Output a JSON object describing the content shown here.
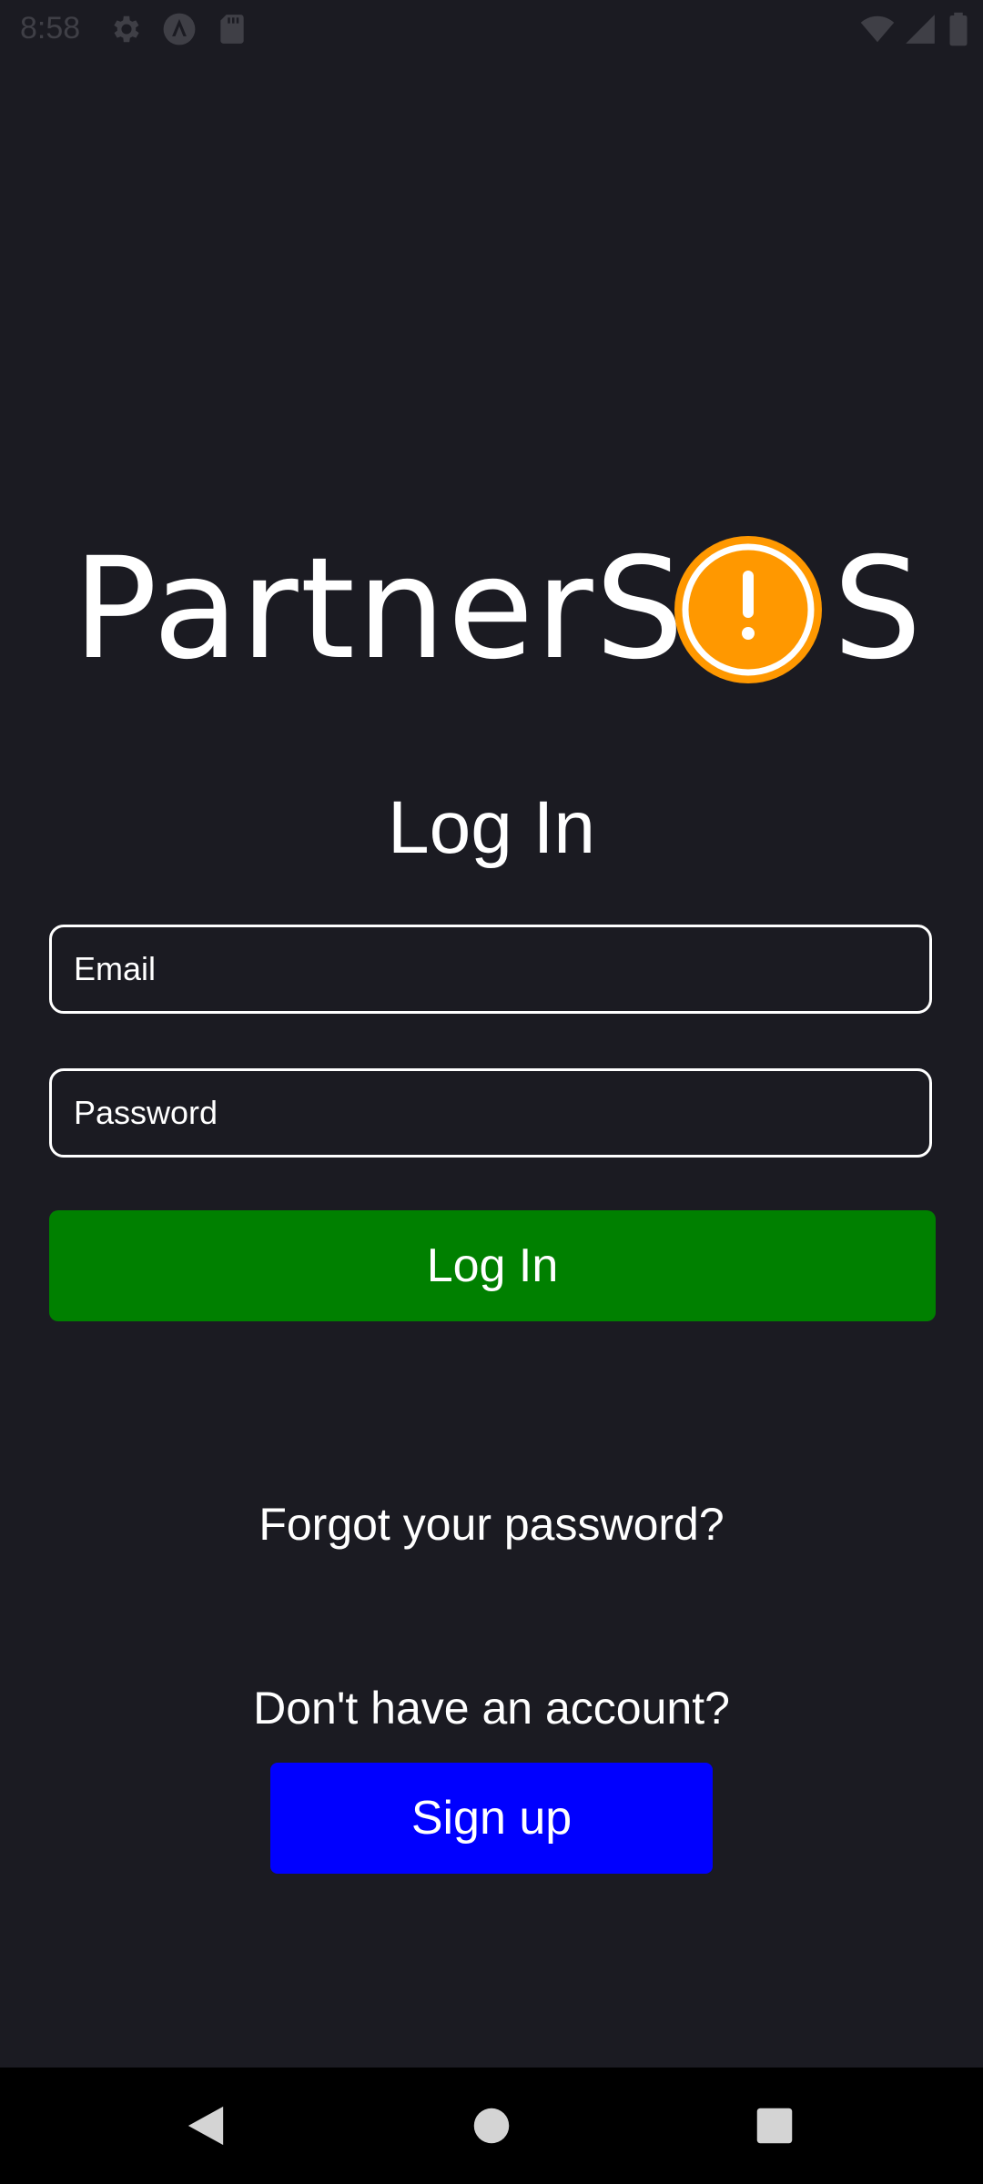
{
  "status_bar": {
    "time": "8:58",
    "icons_left": [
      "settings-gear-icon",
      "app-a-icon",
      "sd-card-icon"
    ],
    "icons_right": [
      "wifi-icon",
      "cellular-signal-icon",
      "battery-icon"
    ]
  },
  "logo": {
    "text": "PartnerSOS",
    "accent_color": "#ff9800"
  },
  "login": {
    "title": "Log In",
    "email_placeholder": "Email",
    "password_placeholder": "Password",
    "submit_label": "Log In",
    "submit_color": "#008000"
  },
  "links": {
    "forgot_password": "Forgot your password?",
    "no_account": "Don't have an account?"
  },
  "signup": {
    "label": "Sign up",
    "color": "#0000ff"
  },
  "nav_bar": {
    "icons": [
      "back-icon",
      "home-icon",
      "recents-icon"
    ]
  }
}
